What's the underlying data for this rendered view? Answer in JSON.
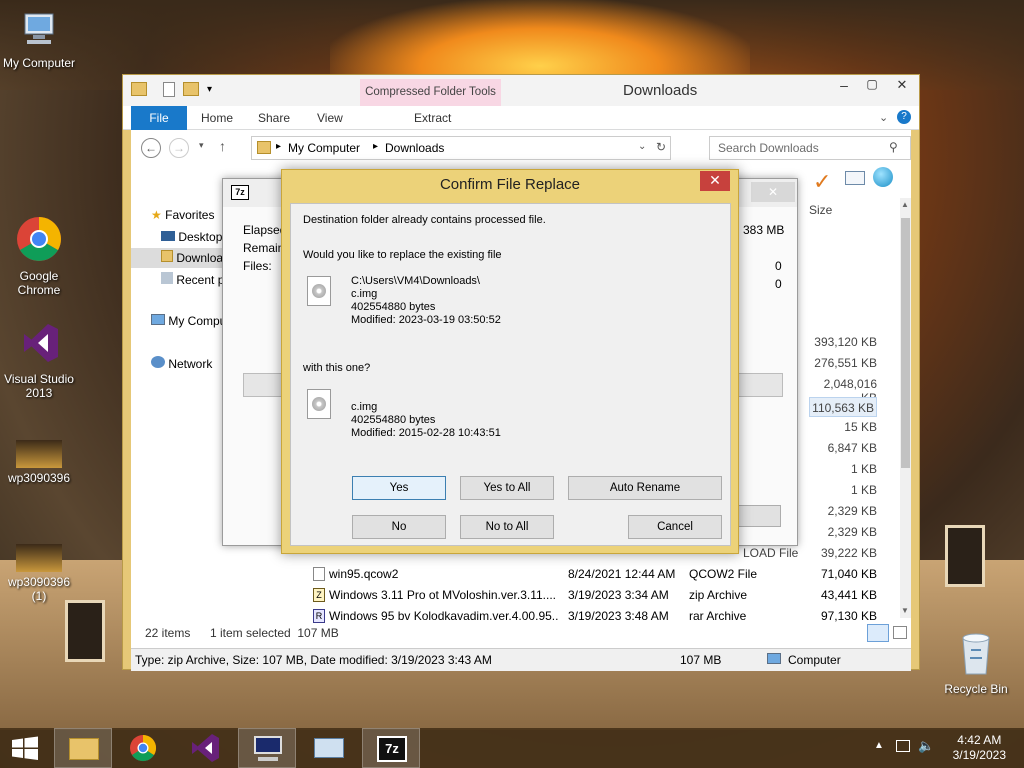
{
  "desktop": {
    "icons": [
      {
        "label": "My Computer",
        "icon": "computer-icon"
      },
      {
        "label": "Google Chrome",
        "icon": "chrome-icon"
      },
      {
        "label": "Visual Studio 2013",
        "icon": "visual-studio-icon"
      },
      {
        "label": "wp3090396",
        "icon": "image-thumbnail-icon"
      },
      {
        "label": "wp3090396 (1)",
        "icon": "image-thumbnail-icon"
      },
      {
        "label": "Recycle Bin",
        "icon": "recycle-bin-icon"
      }
    ]
  },
  "explorer": {
    "title": "Downloads",
    "context_tab_group": "Compressed Folder Tools",
    "tabs": {
      "file": "File",
      "home": "Home",
      "share": "Share",
      "view": "View",
      "extract": "Extract"
    },
    "address": {
      "root": "My Computer",
      "folder": "Downloads"
    },
    "search_placeholder": "Search Downloads",
    "nav": {
      "favorites": "Favorites",
      "desktop": "Desktop",
      "downloads": "Downloads",
      "recent": "Recent places",
      "computer": "My Computer",
      "network": "Network"
    },
    "size_header": "Size",
    "sizes": [
      "393,120 KB",
      "276,551 KB",
      "2,048,016 KB",
      "110,563 KB",
      "15 KB",
      "6,847 KB",
      "1 KB",
      "1 KB",
      "2,329 KB",
      "2,329 KB",
      "39,222 KB"
    ],
    "partial_type": "LOAD File",
    "files": [
      {
        "name": "win95.qcow2",
        "date": "8/24/2021 12:44 AM",
        "type": "QCOW2 File",
        "size": "71,040 KB"
      },
      {
        "name": "Windows 3.11 Pro ot MVoloshin.ver.3.11....",
        "date": "3/19/2023 3:34 AM",
        "type": "zip Archive",
        "size": "43,441 KB"
      },
      {
        "name": "Windows 95 bv Kolodkavadim.ver.4.00.95...",
        "date": "3/19/2023 3:48 AM",
        "type": "rar Archive",
        "size": "97,130 KB"
      }
    ],
    "status": {
      "items": "22 items",
      "selected": "1 item selected  107 MB"
    },
    "details": {
      "text": "Type: zip Archive, Size: 107 MB, Date modified: 3/19/2023 3:43 AM",
      "size": "107 MB",
      "location": "Computer"
    }
  },
  "sevenzip_progress": {
    "elapsed": "Elapsed",
    "remaining": "Remaining",
    "files": "Files:",
    "size": "383 MB",
    "v1": "0",
    "v2": "0"
  },
  "confirm": {
    "title": "Confirm File Replace",
    "close": "✕",
    "msg1": "Destination folder already contains processed file.",
    "msg2": "Would you like to replace the existing file",
    "existing": {
      "path": "C:\\Users\\VM4\\Downloads\\",
      "name": "c.img",
      "bytes": "402554880 bytes",
      "modified": "Modified: 2023-03-19 03:50:52"
    },
    "msg3": "with this one?",
    "incoming": {
      "name": "c.img",
      "bytes": "402554880 bytes",
      "modified": "Modified: 2015-02-28 10:43:51"
    },
    "buttons": {
      "yes": "Yes",
      "yes_all": "Yes to All",
      "auto_rename": "Auto Rename",
      "no": "No",
      "no_all": "No to All",
      "cancel": "Cancel"
    }
  },
  "taskbar": {
    "time": "4:42 AM",
    "date": "3/19/2023",
    "apps": [
      "start-icon",
      "file-explorer-icon",
      "chrome-icon",
      "visual-studio-icon",
      "computer-icon",
      "keyboard-icon",
      "7zip-icon"
    ]
  }
}
